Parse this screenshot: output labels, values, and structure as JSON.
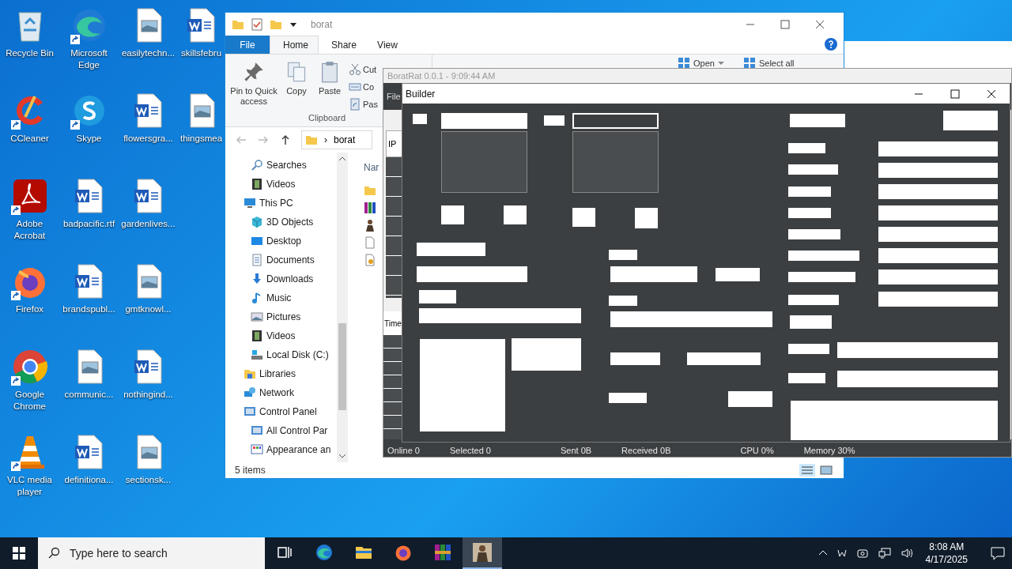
{
  "desktop": {
    "icons": [
      {
        "label": "Recycle Bin",
        "kind": "recycle",
        "shortcut": false
      },
      {
        "label": "CCleaner",
        "kind": "ccleaner",
        "shortcut": true
      },
      {
        "label": "Adobe Acrobat",
        "kind": "acrobat",
        "shortcut": true
      },
      {
        "label": "Firefox",
        "kind": "firefox",
        "shortcut": true
      },
      {
        "label": "Google Chrome",
        "kind": "chrome",
        "shortcut": true
      },
      {
        "label": "VLC media player",
        "kind": "vlc",
        "shortcut": true
      },
      {
        "label": "Microsoft Edge",
        "kind": "edge",
        "shortcut": true
      },
      {
        "label": "Skype",
        "kind": "skype",
        "shortcut": true
      },
      {
        "label": "badpacific.rtf",
        "kind": "word",
        "shortcut": false
      },
      {
        "label": "brandspubl...",
        "kind": "word",
        "shortcut": false
      },
      {
        "label": "communic...",
        "kind": "image",
        "shortcut": false
      },
      {
        "label": "definitiona...",
        "kind": "word",
        "shortcut": false
      },
      {
        "label": "easilytechn...",
        "kind": "image",
        "shortcut": false
      },
      {
        "label": "flowersgra...",
        "kind": "word",
        "shortcut": false
      },
      {
        "label": "gardenlives...",
        "kind": "word",
        "shortcut": false
      },
      {
        "label": "gmtknowl...",
        "kind": "image",
        "shortcut": false
      },
      {
        "label": "nothingind...",
        "kind": "word",
        "shortcut": false
      },
      {
        "label": "sectionsk...",
        "kind": "image",
        "shortcut": false
      },
      {
        "label": "skillsfebru",
        "kind": "word",
        "shortcut": false
      },
      {
        "label": "thingsmea",
        "kind": "image",
        "shortcut": false
      }
    ]
  },
  "explorer": {
    "title": "borat",
    "tabs": [
      {
        "label": "File",
        "selected": false,
        "kind": "file"
      },
      {
        "label": "Home",
        "selected": true,
        "kind": "tab"
      },
      {
        "label": "Share",
        "selected": false,
        "kind": "tab"
      },
      {
        "label": "View",
        "selected": false,
        "kind": "tab"
      }
    ],
    "ribbon": {
      "large": [
        {
          "label": "Pin to Quick access",
          "kind": "pin"
        },
        {
          "label": "Copy",
          "kind": "copy"
        },
        {
          "label": "Paste",
          "kind": "paste"
        }
      ],
      "small": [
        {
          "label": "Cut",
          "kind": "cut"
        },
        {
          "label": "Co",
          "kind": "copypath"
        },
        {
          "label": "Pas",
          "kind": "shortcut"
        }
      ],
      "group": "Clipboard",
      "right_items": [
        {
          "label": "Open",
          "kind": "dropdown"
        },
        {
          "label": "Select all",
          "kind": "plain"
        }
      ]
    },
    "address": "borat",
    "address_separator": "›",
    "column_header": "Nar",
    "nav_items": [
      {
        "children": [
          {
            "label": "Searches",
            "kind": "search"
          },
          {
            "label": "Videos",
            "kind": "video"
          }
        ]
      },
      {
        "label": "This PC",
        "kind": "pc",
        "children": [
          {
            "label": "3D Objects",
            "kind": "cube"
          },
          {
            "label": "Desktop",
            "kind": "desktop"
          },
          {
            "label": "Documents",
            "kind": "document"
          },
          {
            "label": "Downloads",
            "kind": "download"
          },
          {
            "label": "Music",
            "kind": "music"
          },
          {
            "label": "Pictures",
            "kind": "picture"
          },
          {
            "label": "Videos",
            "kind": "video"
          },
          {
            "label": "Local Disk (C:)",
            "kind": "disk"
          }
        ]
      },
      {
        "label": "Libraries",
        "kind": "library"
      },
      {
        "label": "Network",
        "kind": "network"
      },
      {
        "label": "Control Panel",
        "kind": "control",
        "children": [
          {
            "label": "All Control Par",
            "kind": "control"
          },
          {
            "label": "Appearance an",
            "kind": "appearance"
          }
        ]
      }
    ],
    "status": "5 items"
  },
  "borat": {
    "title": "BoratRat 0.0.1 - 9:09:44 AM",
    "menu": "File",
    "header_1": "IP",
    "header_2": "Time",
    "status": [
      "Online 0",
      "Selected 0",
      "Sent 0B",
      "Received 0B",
      "CPU 0%",
      "Memory 30%"
    ]
  },
  "builder": {
    "title": "Builder"
  },
  "taskbar": {
    "search_placeholder": "Type here to search",
    "apps": [
      {
        "kind": "taskview",
        "selected": false
      },
      {
        "kind": "edge",
        "selected": false
      },
      {
        "kind": "folder",
        "selected": false
      },
      {
        "kind": "firefox",
        "selected": false
      },
      {
        "kind": "winrar",
        "selected": false
      },
      {
        "kind": "figure",
        "selected": true
      }
    ],
    "time": "8:08 AM",
    "date": "4/17/2025"
  }
}
